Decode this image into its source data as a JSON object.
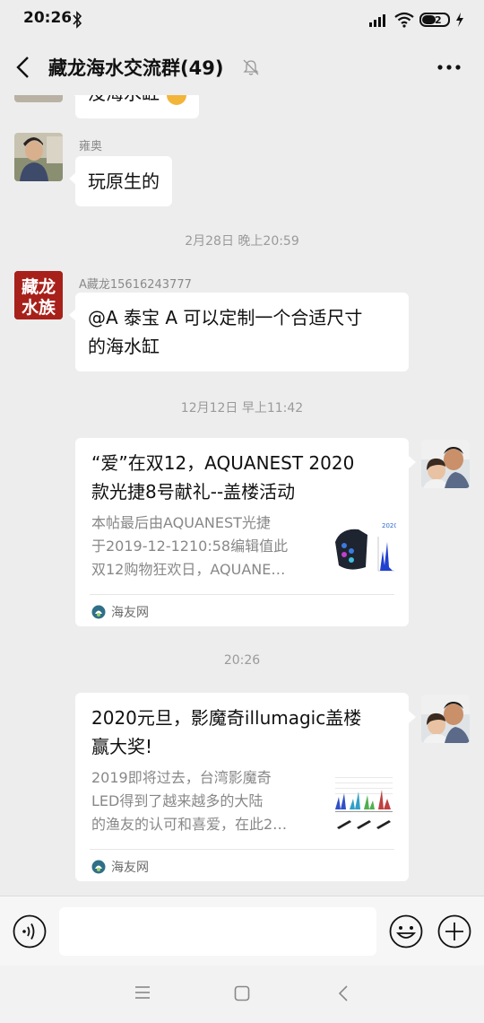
{
  "status_bar": {
    "time": "20:26",
    "battery": "42"
  },
  "header": {
    "title": "藏龙海水交流群(49)"
  },
  "messages": [
    {
      "text": "没海水缸"
    },
    {
      "sender": "雍奥",
      "text": "玩原生的"
    },
    {
      "sender": "A藏龙15616243777",
      "avatar_text": "藏龙水族",
      "text_line1": "@A 泰宝 A  可以定制一个合适尺寸",
      "text_line2": "的海水缸"
    }
  ],
  "timestamps": [
    "2月28日 晚上20:59",
    "12月12日 早上11:42",
    "20:26"
  ],
  "cards": [
    {
      "title_line1": "“爱”在双12，AQUANEST 2020",
      "title_line2": "款光捷8号献礼--盖楼活动",
      "desc_line1": "本帖最后由AQUANEST光捷",
      "desc_line2": "于2019-12-1210:58编辑值此",
      "desc_line3": "双12购物狂欢日，AQUANE…",
      "source": "海友网"
    },
    {
      "title_line1": "2020元旦，影魔奇illumagic盖楼",
      "title_line2": "赢大奖!",
      "desc_line1": "2019即将过去，台湾影魔奇",
      "desc_line2": "LED得到了越来越多的大陆",
      "desc_line3": "的渔友的认可和喜爱，在此2…",
      "source": "海友网"
    }
  ],
  "input": {
    "placeholder": ""
  },
  "colors": {
    "background": "#ededed",
    "bubble": "#ffffff",
    "avatar_red": "#a8201a"
  }
}
